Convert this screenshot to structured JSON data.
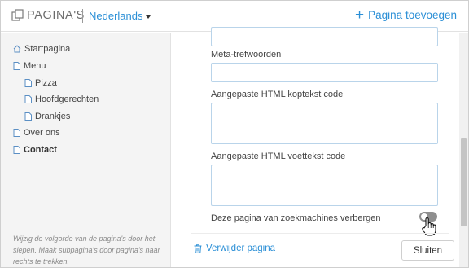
{
  "header": {
    "title": "PAGINA'S",
    "language": "Nederlands",
    "add_page_label": "Pagina toevoegen"
  },
  "sidebar": {
    "items": [
      {
        "label": "Startpagina",
        "icon": "home-icon"
      },
      {
        "label": "Menu",
        "icon": "page-icon"
      },
      {
        "label": "Pizza",
        "icon": "page-icon"
      },
      {
        "label": "Hoofdgerechten",
        "icon": "page-icon"
      },
      {
        "label": "Drankjes",
        "icon": "page-icon"
      },
      {
        "label": "Over ons",
        "icon": "page-icon"
      },
      {
        "label": "Contact",
        "icon": "page-icon"
      }
    ],
    "help_text": "Wijzig de volgorde van de pagina's door het slepen. Maak subpagina's door pagina's naar rechts te trekken."
  },
  "form": {
    "meta_keywords_label": "Meta-trefwoorden",
    "meta_keywords_value": "",
    "custom_header_label": "Aangepaste HTML koptekst code",
    "custom_header_value": "",
    "custom_footer_label": "Aangepaste HTML voettekst code",
    "custom_footer_value": "",
    "hide_from_search_label": "Deze pagina van zoekmachines verbergen",
    "hide_from_search_enabled": false
  },
  "footer": {
    "delete_label": "Verwijder pagina",
    "close_label": "Sluiten"
  },
  "colors": {
    "accent": "#2b8fd6",
    "toggle_off": "#8f8f8f",
    "sidebar_bg": "#f4f4f4"
  }
}
